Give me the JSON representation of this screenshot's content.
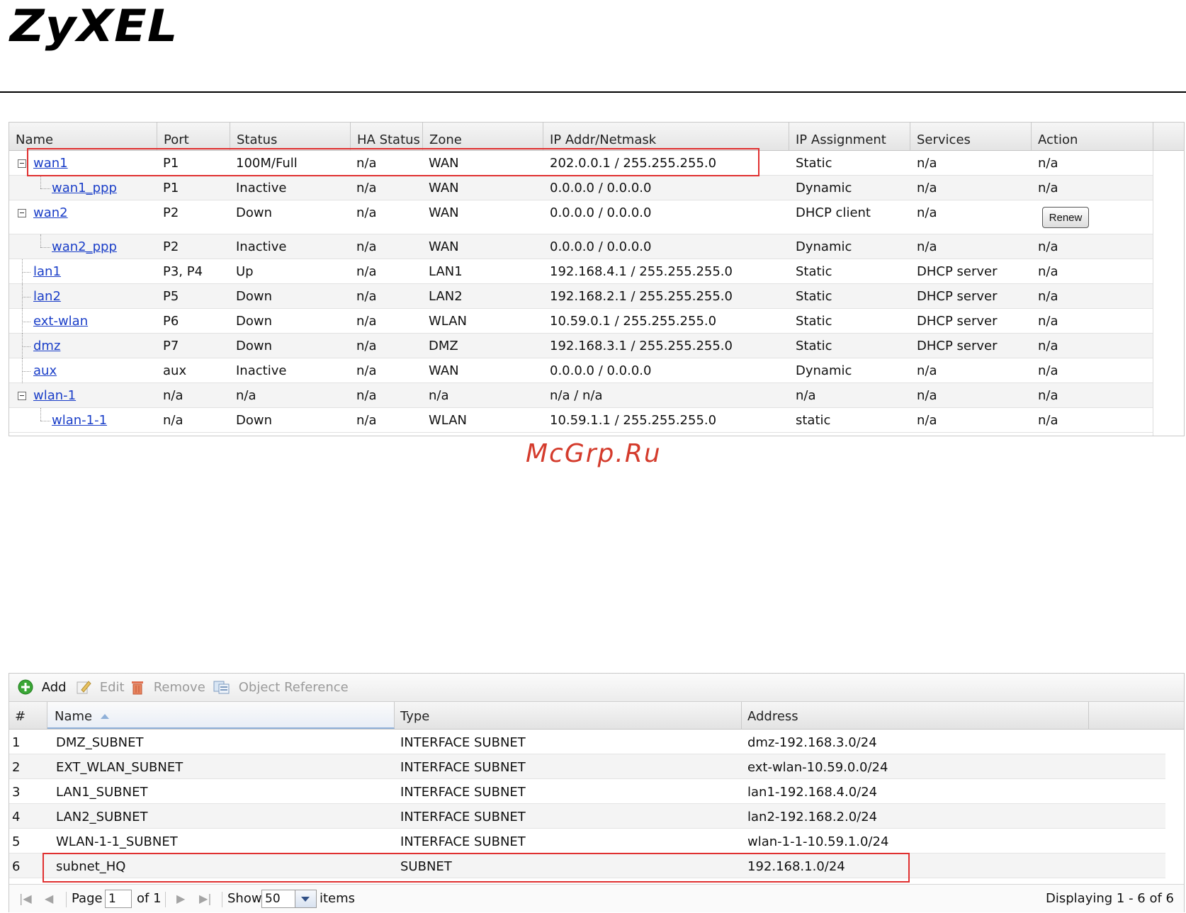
{
  "brand": {
    "logo": "ZyXEL"
  },
  "watermark": "McGrp.Ru",
  "interfaces": {
    "columns": [
      "Name",
      "Port",
      "Status",
      "HA Status",
      "Zone",
      "IP Addr/Netmask",
      "IP Assignment",
      "Services",
      "Action"
    ],
    "rows": [
      {
        "name": "wan1",
        "port": "P1",
        "status": "100M/Full",
        "ha": "n/a",
        "zone": "WAN",
        "ip": "202.0.0.1 / 255.255.255.0",
        "assign": "Static",
        "services": "n/a",
        "action": "n/a"
      },
      {
        "name": "wan1_ppp",
        "port": "P1",
        "status": "Inactive",
        "ha": "n/a",
        "zone": "WAN",
        "ip": "0.0.0.0 / 0.0.0.0",
        "assign": "Dynamic",
        "services": "n/a",
        "action": "n/a"
      },
      {
        "name": "wan2",
        "port": "P2",
        "status": "Down",
        "ha": "n/a",
        "zone": "WAN",
        "ip": "0.0.0.0 / 0.0.0.0",
        "assign": "DHCP client",
        "services": "n/a",
        "action": "Renew"
      },
      {
        "name": "wan2_ppp",
        "port": "P2",
        "status": "Inactive",
        "ha": "n/a",
        "zone": "WAN",
        "ip": "0.0.0.0 / 0.0.0.0",
        "assign": "Dynamic",
        "services": "n/a",
        "action": "n/a"
      },
      {
        "name": "lan1",
        "port": "P3, P4",
        "status": "Up",
        "ha": "n/a",
        "zone": "LAN1",
        "ip": "192.168.4.1 / 255.255.255.0",
        "assign": "Static",
        "services": "DHCP server",
        "action": "n/a"
      },
      {
        "name": "lan2",
        "port": "P5",
        "status": "Down",
        "ha": "n/a",
        "zone": "LAN2",
        "ip": "192.168.2.1 / 255.255.255.0",
        "assign": "Static",
        "services": "DHCP server",
        "action": "n/a"
      },
      {
        "name": "ext-wlan",
        "port": "P6",
        "status": "Down",
        "ha": "n/a",
        "zone": "WLAN",
        "ip": "10.59.0.1 / 255.255.255.0",
        "assign": "Static",
        "services": "DHCP server",
        "action": "n/a"
      },
      {
        "name": "dmz",
        "port": "P7",
        "status": "Down",
        "ha": "n/a",
        "zone": "DMZ",
        "ip": "192.168.3.1 / 255.255.255.0",
        "assign": "Static",
        "services": "DHCP server",
        "action": "n/a"
      },
      {
        "name": "aux",
        "port": "aux",
        "status": "Inactive",
        "ha": "n/a",
        "zone": "WAN",
        "ip": "0.0.0.0 / 0.0.0.0",
        "assign": "Dynamic",
        "services": "n/a",
        "action": "n/a"
      },
      {
        "name": "wlan-1",
        "port": "n/a",
        "status": "n/a",
        "ha": "n/a",
        "zone": "n/a",
        "ip": "n/a / n/a",
        "assign": "n/a",
        "services": "n/a",
        "action": "n/a"
      },
      {
        "name": "wlan-1-1",
        "port": "n/a",
        "status": "Down",
        "ha": "n/a",
        "zone": "WLAN",
        "ip": "10.59.1.1 / 255.255.255.0",
        "assign": "static",
        "services": "n/a",
        "action": "n/a"
      }
    ]
  },
  "addresses": {
    "toolbar": {
      "add": "Add",
      "edit": "Edit",
      "remove": "Remove",
      "reference": "Object Reference"
    },
    "columns": [
      "#",
      "Name",
      "Type",
      "Address"
    ],
    "rows": [
      {
        "num": "1",
        "name": "DMZ_SUBNET",
        "type": "INTERFACE SUBNET",
        "address": "dmz-192.168.3.0/24"
      },
      {
        "num": "2",
        "name": "EXT_WLAN_SUBNET",
        "type": "INTERFACE SUBNET",
        "address": "ext-wlan-10.59.0.0/24"
      },
      {
        "num": "3",
        "name": "LAN1_SUBNET",
        "type": "INTERFACE SUBNET",
        "address": "lan1-192.168.4.0/24"
      },
      {
        "num": "4",
        "name": "LAN2_SUBNET",
        "type": "INTERFACE SUBNET",
        "address": "lan2-192.168.2.0/24"
      },
      {
        "num": "5",
        "name": "WLAN-1-1_SUBNET",
        "type": "INTERFACE SUBNET",
        "address": "wlan-1-1-10.59.1.0/24"
      },
      {
        "num": "6",
        "name": "subnet_HQ",
        "type": "SUBNET",
        "address": "192.168.1.0/24"
      }
    ],
    "pager": {
      "page_label": "Page",
      "page_value": "1",
      "of_label": "of 1",
      "show_label": "Show",
      "show_value": "50",
      "items_label": "items",
      "display_text": "Displaying 1 - 6 of 6"
    }
  }
}
